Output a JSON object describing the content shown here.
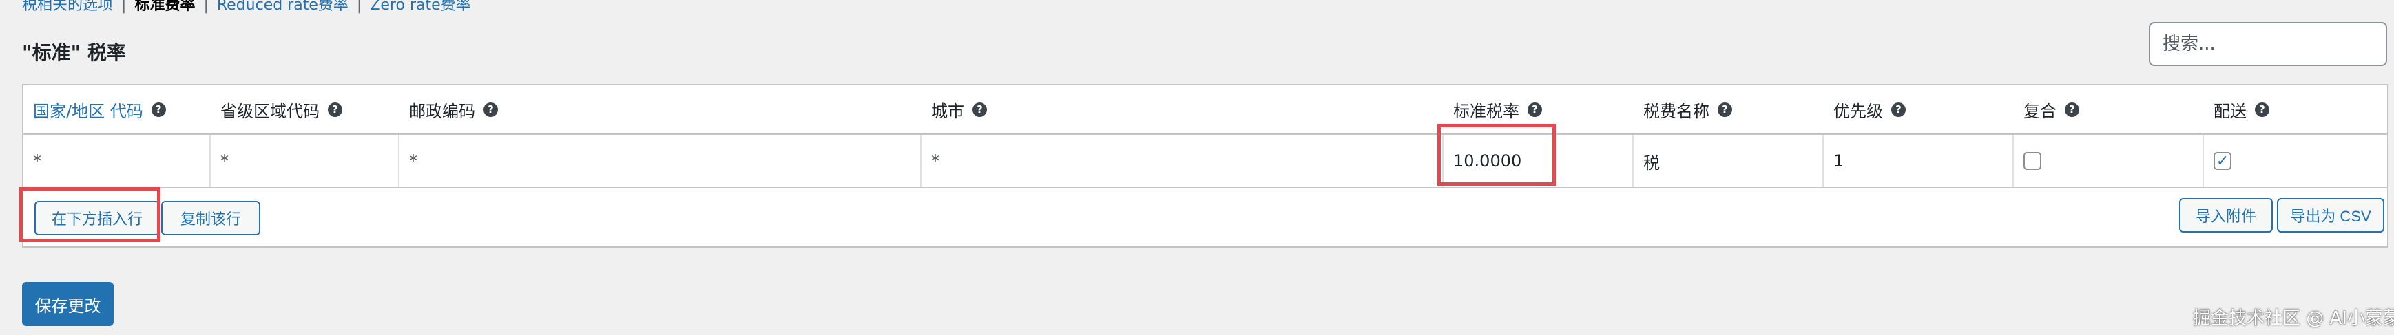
{
  "subnav": {
    "item1": "税相关的选项",
    "item2": "标准费率",
    "item3": "Reduced rate费率",
    "item4": "Zero rate费率",
    "sep": "|"
  },
  "section_title": "\"标准\" 税率",
  "search": {
    "placeholder": "搜索..."
  },
  "table": {
    "headers": [
      "国家/地区 代码",
      "省级区域代码",
      "邮政编码",
      "城市",
      "标准税率",
      "税费名称",
      "优先级",
      "复合",
      "配送"
    ],
    "help_glyph": "?",
    "row": {
      "country": "*",
      "state": "*",
      "postcode": "*",
      "city": "*",
      "rate": "10.0000",
      "name": "税",
      "priority": "1",
      "compound": false,
      "shipping": true
    }
  },
  "buttons": {
    "insert_row": "在下方插入行",
    "copy_row": "复制该行",
    "import": "导入附件",
    "export": "导出为 CSV",
    "save": "保存更改"
  },
  "watermark": "掘金技术社区 @ AI小蒙蒙",
  "colors": {
    "accent": "#2271b1",
    "highlight": "#e5484d"
  }
}
